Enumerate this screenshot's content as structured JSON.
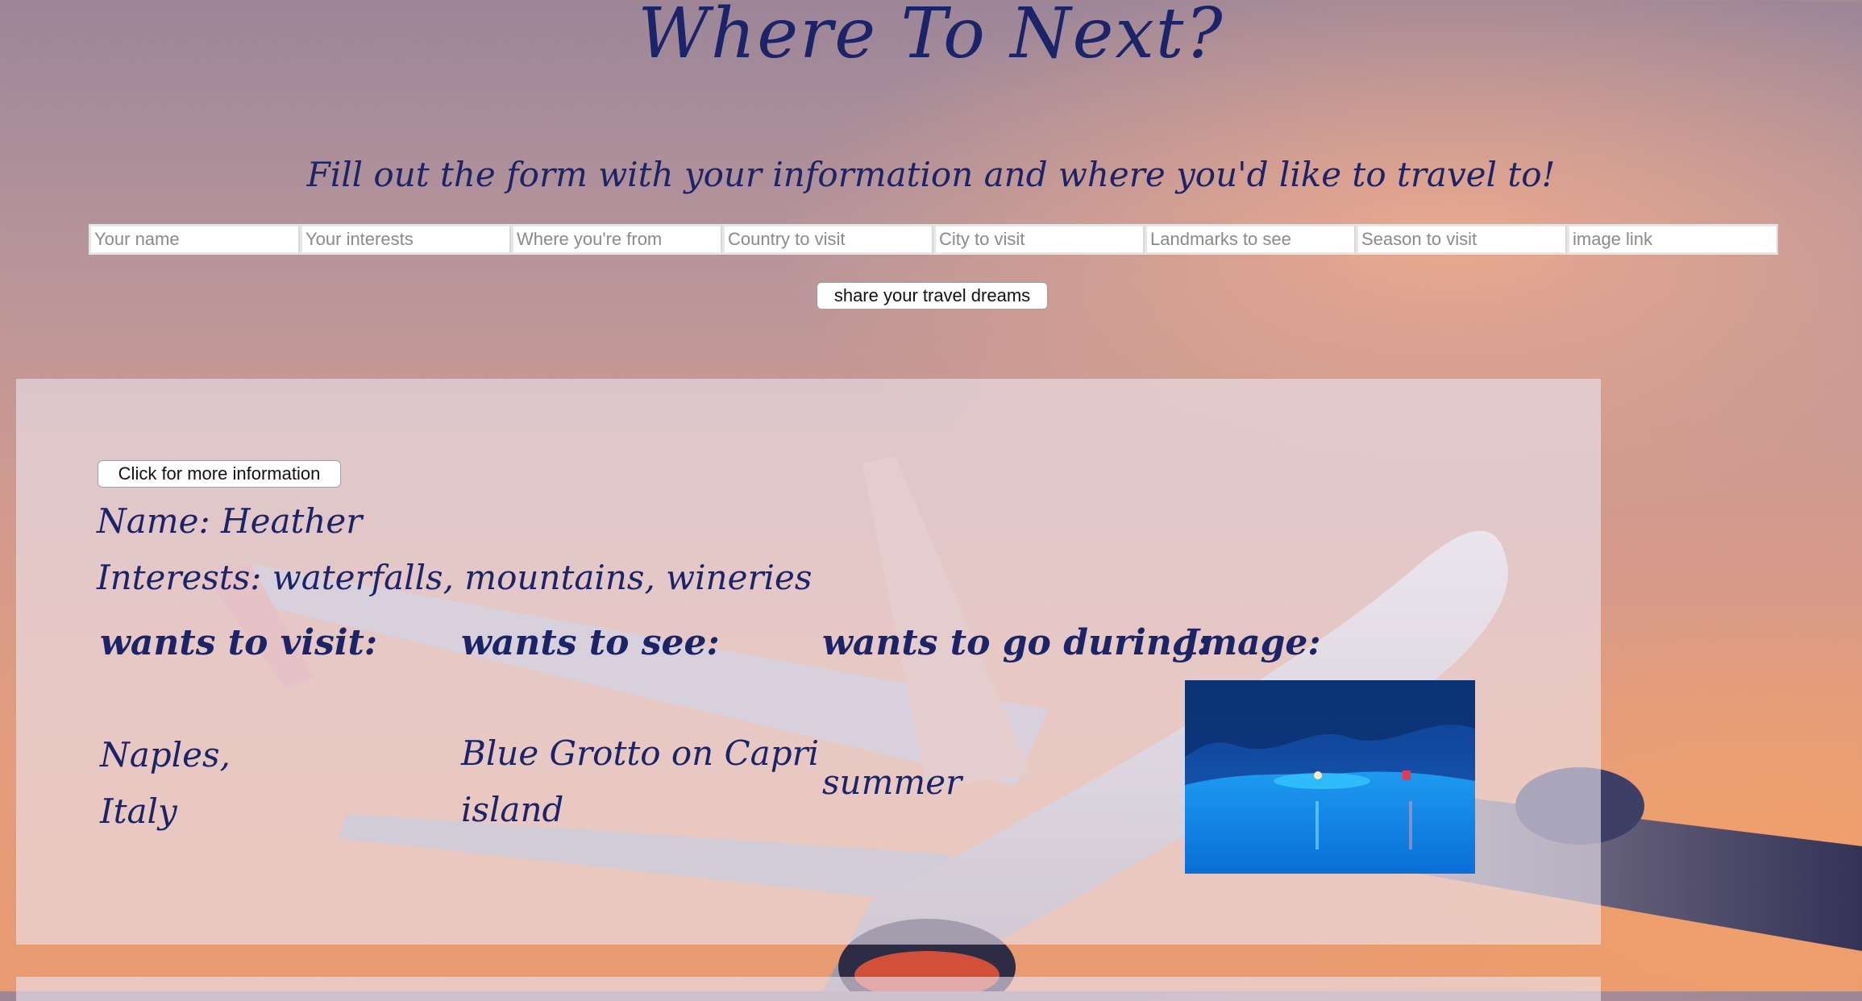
{
  "header": {
    "title": "Where To Next?",
    "subtitle": "Fill out the form with your information and where you'd like to travel to!"
  },
  "form": {
    "fields": [
      {
        "placeholder": "Your name"
      },
      {
        "placeholder": "Your interests"
      },
      {
        "placeholder": "Where you're from"
      },
      {
        "placeholder": "Country to visit"
      },
      {
        "placeholder": "City to visit"
      },
      {
        "placeholder": "Landmarks to see"
      },
      {
        "placeholder": "Season to visit"
      },
      {
        "placeholder": "image link"
      }
    ],
    "submit_label": "share your travel dreams"
  },
  "card": {
    "more_info_label": "Click for more information",
    "name_line": "Name: Heather",
    "interests_line": "Interests: waterfalls, mountains, wineries",
    "columns": {
      "visit_heading": "wants to visit:",
      "see_heading": "wants to see:",
      "season_heading": "wants to go during:",
      "image_heading": "Image:"
    },
    "visit": {
      "city": "Naples,",
      "country": "Italy"
    },
    "see": {
      "line1": "Blue Grotto on Capri",
      "line2": "island"
    },
    "season": "summer"
  },
  "colors": {
    "heading": "#1b2369",
    "card_overlay": "rgba(235,228,238,0.62)"
  }
}
